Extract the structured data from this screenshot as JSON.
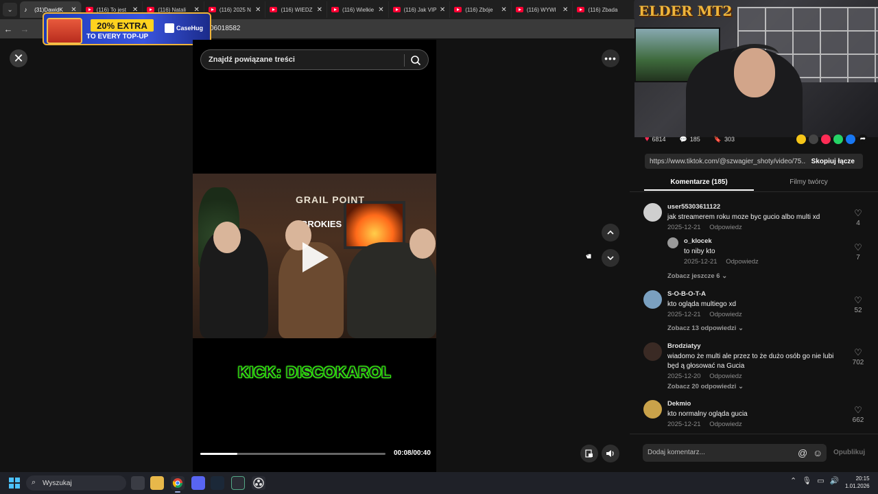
{
  "browser": {
    "tabs": [
      {
        "label": "(31)DawidK",
        "icon": "tiktok-icon",
        "active": true
      },
      {
        "label": "(116) To jest",
        "icon": "youtube-icon"
      },
      {
        "label": "(116) Natali",
        "icon": "youtube-icon"
      },
      {
        "label": "(116) 2025 N",
        "icon": "youtube-icon"
      },
      {
        "label": "(116) WIEDZ",
        "icon": "youtube-icon"
      },
      {
        "label": "(116) Wielkie",
        "icon": "youtube-icon"
      },
      {
        "label": "(116) Jak VIP",
        "icon": "youtube-icon"
      },
      {
        "label": "(116) Zbóje",
        "icon": "youtube-icon"
      },
      {
        "label": "(116) WYWI",
        "icon": "youtube-icon"
      },
      {
        "label": "(116) Zbada",
        "icon": "youtube-icon"
      }
    ],
    "url_fragment": "06018582"
  },
  "ad": {
    "title": "20% EXTRA",
    "subtitle": "TO EVERY TOP-UP",
    "brand": "CaseHug"
  },
  "viewer": {
    "search_placeholder": "Znajdź powiązane treści",
    "overlay_text": "KICK: DISCOKAROL",
    "scene_sign": "GRAIL POINT",
    "scene_sign2": "BROKIES",
    "time": "00:08/00:40",
    "progress": 0.2
  },
  "webcam": {
    "logo": "ELDER MT2"
  },
  "stats": {
    "likes": "6814",
    "comments": "185",
    "saves": "303"
  },
  "link": {
    "url": "https://www.tiktok.com/@szwagier_shoty/video/75...",
    "copy_label": "Skopiuj łącze"
  },
  "tabs": {
    "comments": "Komentarze (185)",
    "creator_videos": "Filmy twórcy"
  },
  "comments": [
    {
      "user": "user55303611122",
      "text": "jak streamerem roku moze byc gucio albo multi xd",
      "date": "2025-12-21",
      "reply": "Odpowiedz",
      "likes": "4"
    },
    {
      "user": "o_klocek",
      "text": "to niby kto",
      "date": "2025-12-21",
      "reply": "Odpowiedz",
      "likes": "7"
    },
    {
      "user": "S-O-B-O-T-A",
      "text": "kto ogląda multiego xd",
      "date": "2025-12-21",
      "reply": "Odpowiedz",
      "likes": "52"
    },
    {
      "user": "Brodziatyy",
      "text": "wiadomo że multi ale przez to że dużo osób go nie lubi będ ą głosować na Gucia",
      "date": "2025-12-20",
      "reply": "Odpowiedz",
      "likes": "702"
    },
    {
      "user": "Dekmio",
      "text": "kto normalny ogląda gucia",
      "date": "2025-12-21",
      "reply": "Odpowiedz",
      "likes": "662"
    }
  ],
  "see_more": {
    "c1": "Zobacz jeszcze 6",
    "c3": "Zobacz 13 odpowiedzi",
    "c4": "Zobacz 20 odpowiedzi"
  },
  "composer": {
    "placeholder": "Dodaj komentarz...",
    "post_label": "Opublikuj"
  },
  "taskbar": {
    "search_label": "Wyszukaj",
    "time": "20:15",
    "date": "1.01.2026"
  }
}
